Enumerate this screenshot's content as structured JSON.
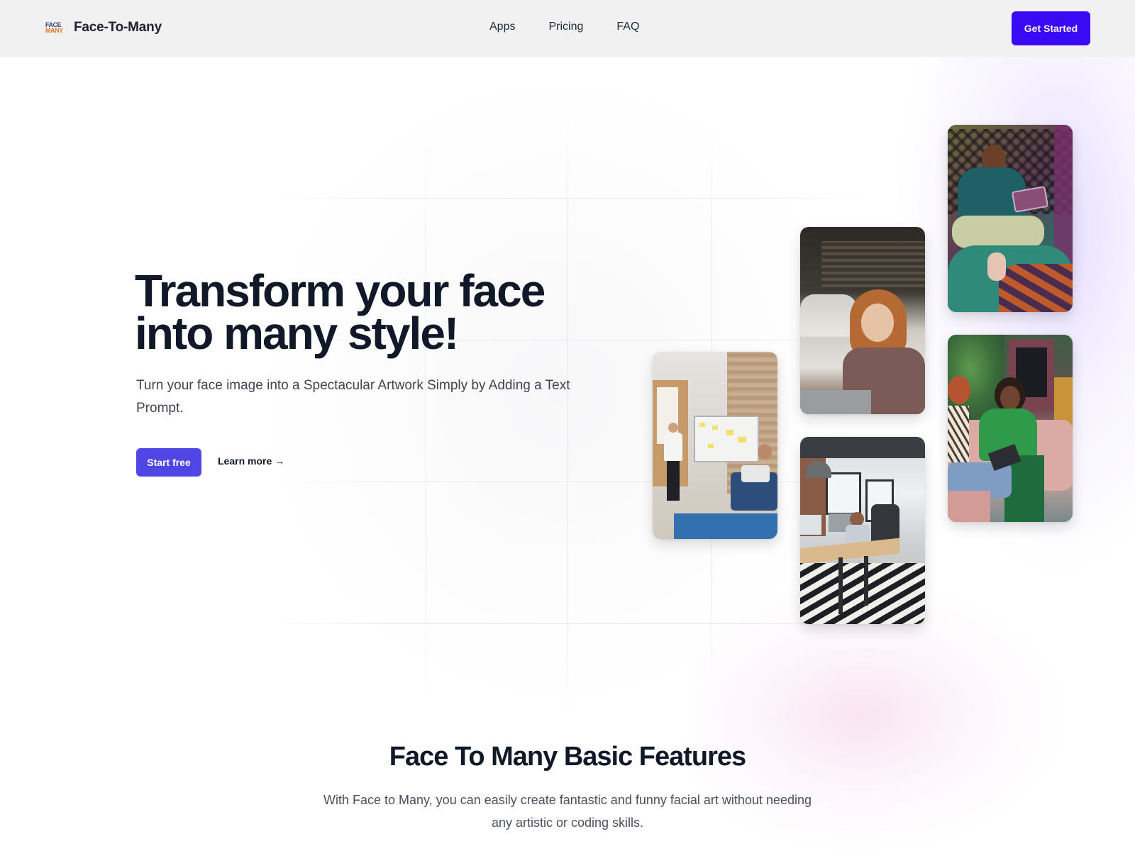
{
  "header": {
    "logo_mark": {
      "line1": "FACE",
      "line2": "MANY"
    },
    "brand_name": "Face-To-Many",
    "nav": [
      {
        "label": "Apps"
      },
      {
        "label": "Pricing"
      },
      {
        "label": "FAQ"
      }
    ],
    "cta_label": "Get Started"
  },
  "hero": {
    "title_line1": "Transform your face",
    "title_line2": "into many style!",
    "subtitle": "Turn your face image into a Spectacular Artwork Simply by Adding a Text Prompt.",
    "primary_button": "Start free",
    "secondary_link": "Learn more",
    "secondary_link_icon": "→"
  },
  "gallery": [
    {
      "id": "team-whiteboard-meeting",
      "alt": "Man presenting at a whiteboard with sticky notes to colleagues on a blue sofa"
    },
    {
      "id": "woman-laptop-cafe",
      "alt": "Smiling red-haired woman working on a laptop in a cafe"
    },
    {
      "id": "open-office-desks",
      "alt": "Colleagues working at desks in a loft office with striped carpet"
    },
    {
      "id": "man-with-tablet",
      "alt": "Laughing man in a teal sweater holding a tablet"
    },
    {
      "id": "women-on-sofa",
      "alt": "Two women laughing together on a pink sofa with a laptop"
    }
  ],
  "features": {
    "title": "Face To Many Basic Features",
    "subtitle": "With Face to Many, you can easily create fantastic and funny facial art without needing any artistic or coding skills."
  },
  "colors": {
    "header_bg": "#f1f1f2",
    "cta_top": "#3b0af5",
    "primary_button": "#4f46e5",
    "heading_text": "#111827",
    "body_text": "#3f4451"
  }
}
